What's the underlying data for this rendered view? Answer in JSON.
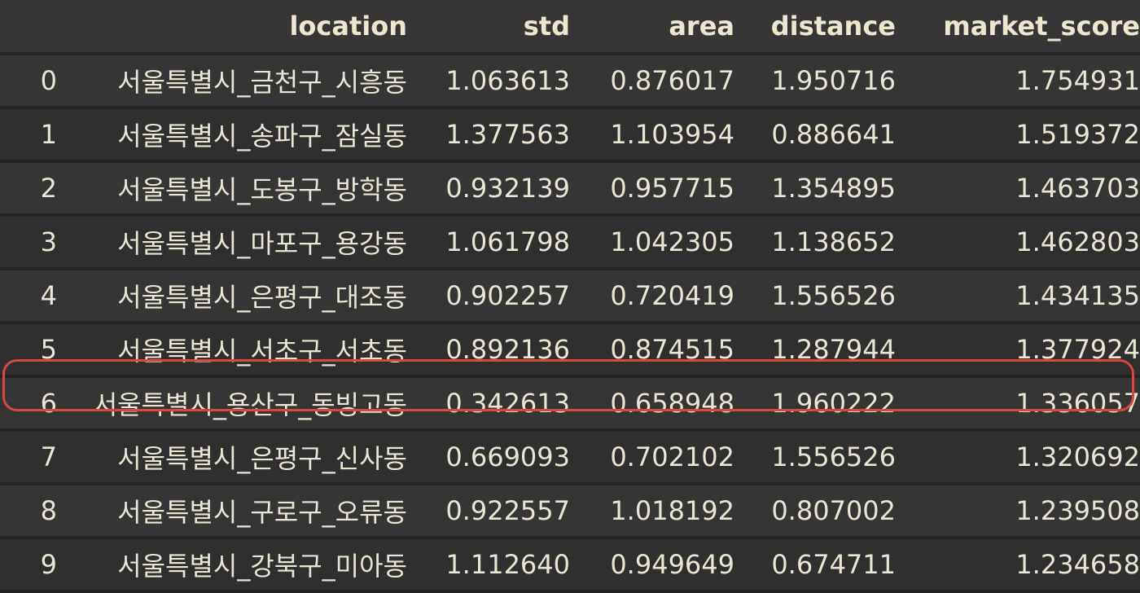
{
  "table": {
    "columns": [
      "location",
      "std",
      "area",
      "distance",
      "market_score"
    ],
    "rows": [
      {
        "index": "0",
        "location": "서울특별시_금천구_시흥동",
        "std": "1.063613",
        "area": "0.876017",
        "distance": "1.950716",
        "market_score": "1.754931"
      },
      {
        "index": "1",
        "location": "서울특별시_송파구_잠실동",
        "std": "1.377563",
        "area": "1.103954",
        "distance": "0.886641",
        "market_score": "1.519372"
      },
      {
        "index": "2",
        "location": "서울특별시_도봉구_방학동",
        "std": "0.932139",
        "area": "0.957715",
        "distance": "1.354895",
        "market_score": "1.463703"
      },
      {
        "index": "3",
        "location": "서울특별시_마포구_용강동",
        "std": "1.061798",
        "area": "1.042305",
        "distance": "1.138652",
        "market_score": "1.462803"
      },
      {
        "index": "4",
        "location": "서울특별시_은평구_대조동",
        "std": "0.902257",
        "area": "0.720419",
        "distance": "1.556526",
        "market_score": "1.434135"
      },
      {
        "index": "5",
        "location": "서울특별시_서초구_서초동",
        "std": "0.892136",
        "area": "0.874515",
        "distance": "1.287944",
        "market_score": "1.377924"
      },
      {
        "index": "6",
        "location": "서울특별시_용산구_동빙고동",
        "std": "0.342613",
        "area": "0.658948",
        "distance": "1.960222",
        "market_score": "1.336057"
      },
      {
        "index": "7",
        "location": "서울특별시_은평구_신사동",
        "std": "0.669093",
        "area": "0.702102",
        "distance": "1.556526",
        "market_score": "1.320692"
      },
      {
        "index": "8",
        "location": "서울특별시_구로구_오류동",
        "std": "0.922557",
        "area": "1.018192",
        "distance": "0.807002",
        "market_score": "1.239508"
      },
      {
        "index": "9",
        "location": "서울특별시_강북구_미아동",
        "std": "1.112640",
        "area": "0.949649",
        "distance": "0.674711",
        "market_score": "1.234658"
      }
    ],
    "highlighted_row_index": "6"
  },
  "colors": {
    "background": "#2b2b2b",
    "text": "#ebe5d3",
    "highlight_outline": "#d9483b"
  }
}
